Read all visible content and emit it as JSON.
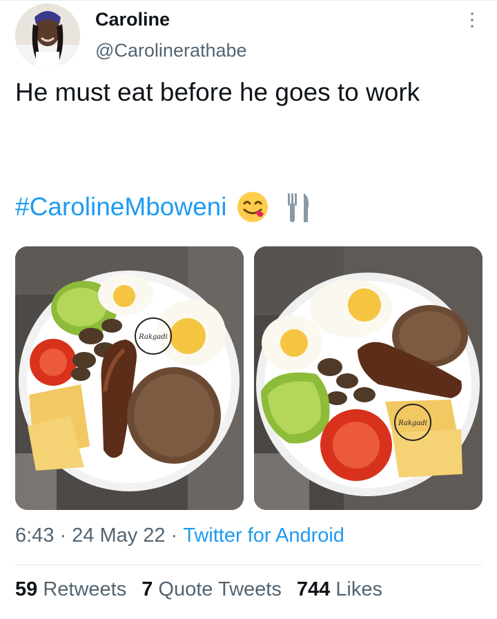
{
  "author": {
    "display_name": "Caroline",
    "handle": "@Carolinerathabe"
  },
  "tweet": {
    "text": "He must eat before he goes to work",
    "hashtag": "#CarolineMboweni",
    "emojis": [
      "face-savoring-food-icon",
      "fork-and-knife-icon"
    ]
  },
  "photos": {
    "watermark": "Rakgadi"
  },
  "meta": {
    "time": "6:43",
    "separator": "·",
    "date": "24 May 22",
    "source": "Twitter for Android"
  },
  "stats": {
    "retweets_count": "59",
    "retweets_label": "Retweets",
    "quotes_count": "7",
    "quotes_label": "Quote Tweets",
    "likes_count": "744",
    "likes_label": "Likes"
  },
  "colors": {
    "link": "#1d9bf0",
    "secondary_text": "#536471",
    "primary_text": "#0f1419"
  }
}
